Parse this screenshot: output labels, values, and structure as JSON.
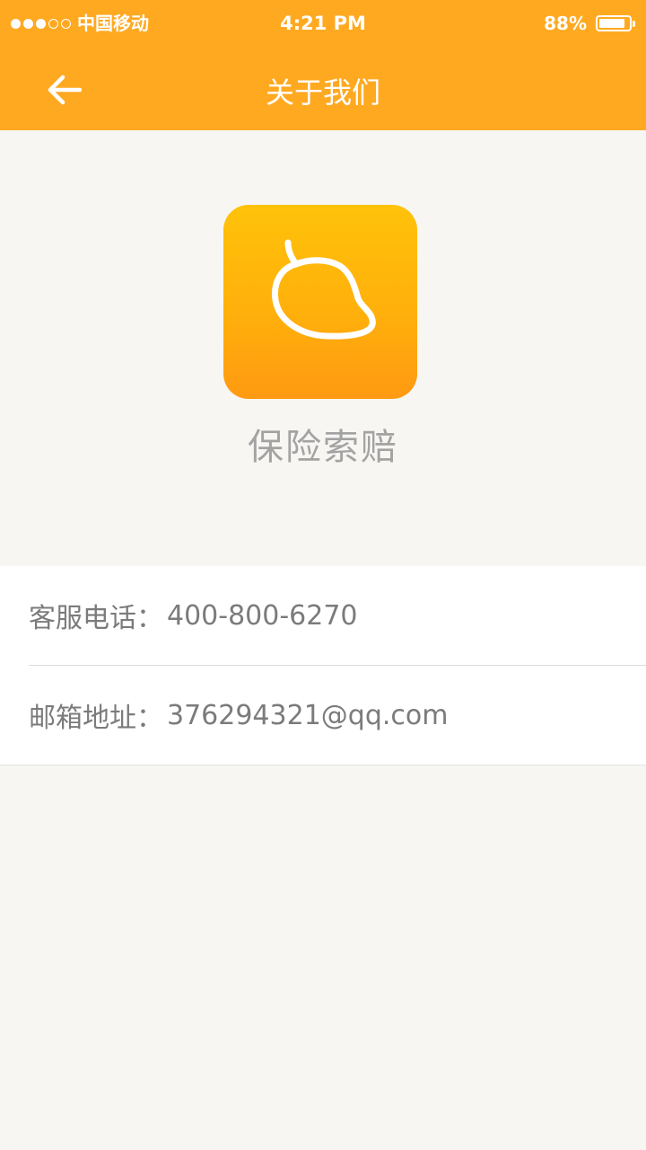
{
  "colors": {
    "header": "#ffa921",
    "background": "#f7f6f3",
    "icon_top": "#ffc20a",
    "icon_bottom": "#ff9a12",
    "secondary_text": "#a3a3a3",
    "body_text": "#7b7b7b"
  },
  "status_bar": {
    "signal_filled": 3,
    "signal_empty": 2,
    "carrier": "中国移动",
    "time": "4:21 PM",
    "battery_percent": "88%",
    "battery_level": 0.88
  },
  "nav": {
    "back_icon": "arrow-left-icon",
    "title": "关于我们"
  },
  "app": {
    "icon": "mango-icon",
    "name": "保险索赔"
  },
  "contact": {
    "phone_label": "客服电话：",
    "phone_value": "400-800-6270",
    "email_label": "邮箱地址：",
    "email_value": "376294321@qq.com"
  }
}
